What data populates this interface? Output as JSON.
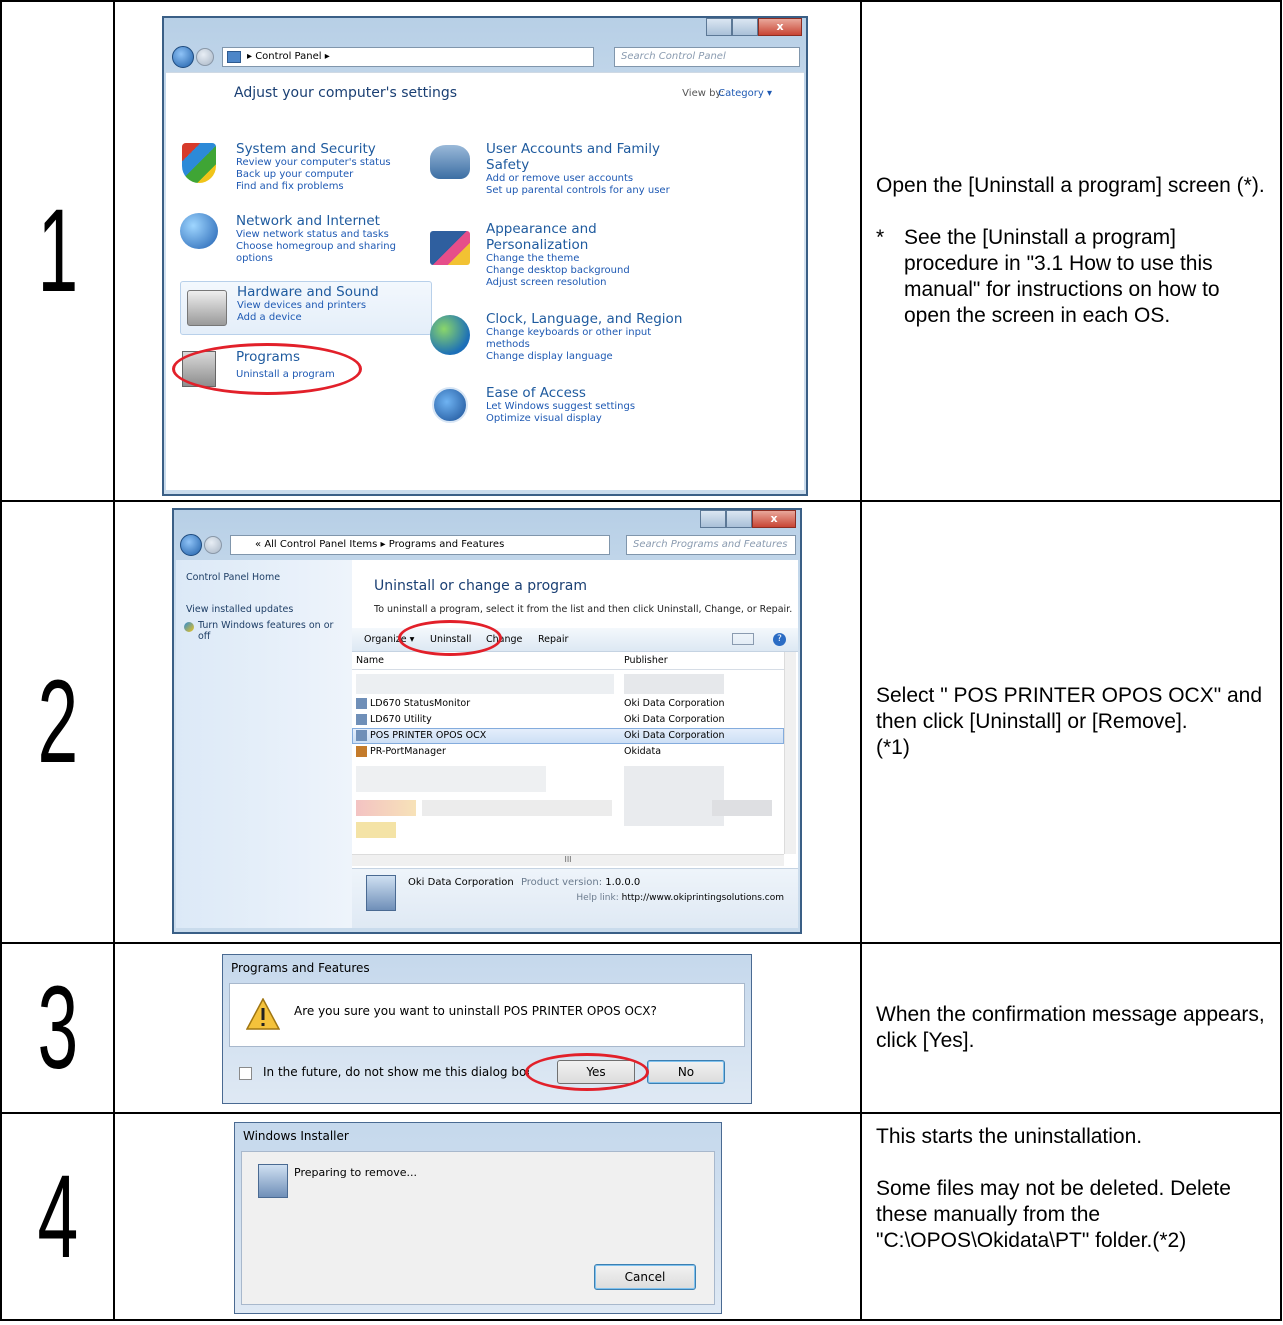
{
  "steps": [
    {
      "number": "1",
      "description": {
        "main": "Open the [Uninstall a program] screen (*).",
        "note_mark": "*",
        "note": "See the [Uninstall a program] procedure in \"3.1 How to use this manual\" for instructions on how to open the screen in each OS."
      },
      "screen": {
        "window_close_glyph": "x",
        "address": "Control Panel",
        "search_placeholder": "Search Control Panel",
        "heading": "Adjust your computer's settings",
        "view_by_label": "View by:",
        "view_by_value": "Category",
        "categories_left": [
          {
            "title": "System and Security",
            "links": [
              "Review your computer's status",
              "Back up your computer",
              "Find and fix problems"
            ],
            "icon": "shield-icon"
          },
          {
            "title": "Network and Internet",
            "links": [
              "View network status and tasks",
              "Choose homegroup and sharing",
              "options"
            ],
            "icon": "network-icon"
          },
          {
            "title": "Hardware and Sound",
            "links": [
              "View devices and printers",
              "Add a device"
            ],
            "icon": "printer-icon"
          },
          {
            "title": "Programs",
            "links": [
              "Uninstall a program"
            ],
            "icon": "programs-icon"
          }
        ],
        "categories_right": [
          {
            "title_lines": [
              "User Accounts and Family",
              "Safety"
            ],
            "links": [
              "Add or remove user accounts",
              "Set up parental controls for any user"
            ],
            "icon": "users-icon"
          },
          {
            "title_lines": [
              "Appearance and",
              "Personalization"
            ],
            "links": [
              "Change the theme",
              "Change desktop background",
              "Adjust screen resolution"
            ],
            "icon": "appearance-icon"
          },
          {
            "title_lines": [
              "Clock, Language, and Region"
            ],
            "links": [
              "Change keyboards or other input",
              "methods",
              "Change display language"
            ],
            "icon": "globe-icon"
          },
          {
            "title_lines": [
              "Ease of Access"
            ],
            "links": [
              "Let Windows suggest settings",
              "Optimize visual display"
            ],
            "icon": "ease-icon"
          }
        ]
      }
    },
    {
      "number": "2",
      "description": {
        "lines": [
          "Select \" POS PRINTER OPOS OCX\" and then click [Uninstall] or [Remove].",
          "(*1)"
        ]
      },
      "screen": {
        "window_close_glyph": "x",
        "breadcrumb_prefix": "«",
        "breadcrumb": "All Control Panel Items ▸ Programs and Features",
        "search_placeholder": "Search Programs and Features",
        "sidebar": [
          "Control Panel Home",
          "View installed updates",
          "Turn Windows features on or off"
        ],
        "heading": "Uninstall or change a program",
        "instruction": "To uninstall a program, select it from the list and then click Uninstall, Change, or Repair.",
        "toolbar": [
          "Organize ▾",
          "Uninstall",
          "Change",
          "Repair"
        ],
        "columns": [
          "Name",
          "Publisher"
        ],
        "rows": [
          {
            "name": "LD670 StatusMonitor",
            "publisher": "Oki Data Corporation"
          },
          {
            "name": "LD670 Utility",
            "publisher": "Oki Data Corporation"
          },
          {
            "name": "POS PRINTER OPOS OCX",
            "publisher": "Oki Data Corporation",
            "selected": true
          },
          {
            "name": "PR-PortManager",
            "publisher": "Okidata"
          }
        ],
        "scroll_marker": "III",
        "details": {
          "publisher": "Oki Data Corporation",
          "version_label": "Product version:",
          "version": "1.0.0.0",
          "help_label": "Help link:",
          "help": "http://www.okiprintingsolutions.com"
        }
      }
    },
    {
      "number": "3",
      "description": {
        "lines": [
          "When the confirmation message appears, click [Yes]."
        ]
      },
      "screen": {
        "title": "Programs and Features",
        "message": "Are you sure you want to uninstall POS PRINTER OPOS OCX?",
        "checkbox_label": "In the future, do not show me this dialog box",
        "yes": "Yes",
        "no": "No"
      }
    },
    {
      "number": "4",
      "description": {
        "lines": [
          "This starts the uninstallation.",
          "Some files may not be deleted. Delete these manually from the \"C:\\OPOS\\Okidata\\PT\" folder.(*2)"
        ]
      },
      "screen": {
        "title": "Windows Installer",
        "message": "Preparing to remove...",
        "cancel": "Cancel"
      }
    }
  ]
}
